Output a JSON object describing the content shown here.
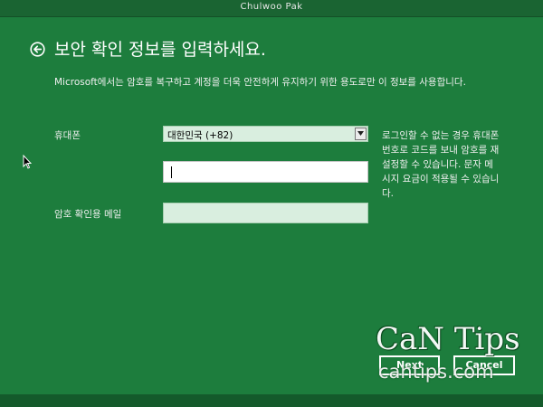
{
  "window": {
    "title": "Chulwoo Pak"
  },
  "page": {
    "heading": "보안 확인 정보를 입력하세요.",
    "description": "Microsoft에서는 암호를 복구하고 계정을 더욱 안전하게 유지하기 위한 용도로만 이 정보를 사용합니다."
  },
  "form": {
    "phone_label": "휴대폰",
    "country_selected": "대한민국 (+82)",
    "phone_value": "",
    "recovery_email_label": "암호 확인용 메일",
    "recovery_email_value": "",
    "hint": "로그인할 수 없는 경우 휴대폰 번호로 코드를 보내 암호를 재설정할 수 있습니다. 문자 메시지 요금이 적용될 수 있습니다."
  },
  "buttons": {
    "next": "Next",
    "cancel": "Cancel"
  },
  "watermark": {
    "brand": "CaN Tips",
    "url": "cantips.com"
  },
  "colors": {
    "background": "#1d7d3d",
    "field": "#d9eedf",
    "text": "#ffffff"
  }
}
